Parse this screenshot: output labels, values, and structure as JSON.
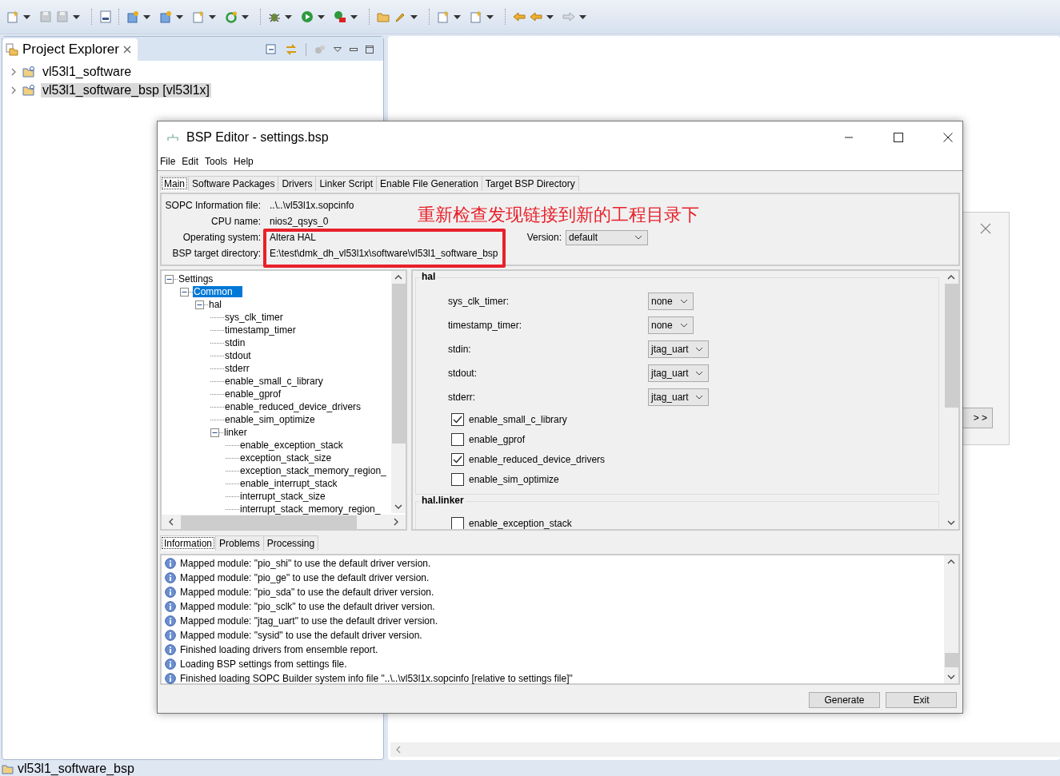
{
  "project_explorer": {
    "title": "Project Explorer",
    "items": [
      {
        "label": "vl53l1_software",
        "expanded": false,
        "selected": false
      },
      {
        "label": "vl53l1_software_bsp [vl53l1x]",
        "expanded": false,
        "selected": true
      }
    ]
  },
  "background_dialog": {
    "button": "> >"
  },
  "dialog": {
    "title": "BSP Editor - settings.bsp",
    "menu": [
      "File",
      "Edit",
      "Tools",
      "Help"
    ],
    "tabs": [
      {
        "label": "Main",
        "selected": true
      },
      {
        "label": "Software Packages",
        "selected": false
      },
      {
        "label": "Drivers",
        "selected": false
      },
      {
        "label": "Linker Script",
        "selected": false
      },
      {
        "label": "Enable File Generation",
        "selected": false
      },
      {
        "label": "Target BSP Directory",
        "selected": false
      }
    ],
    "info": [
      {
        "label": "SOPC Information file:",
        "value": "..\\..\\vl53l1x.sopcinfo"
      },
      {
        "label": "CPU name:",
        "value": "nios2_qsys_0"
      },
      {
        "label": "Operating system:",
        "value": "Altera HAL",
        "version": {
          "label": "Version:",
          "value": "default"
        }
      },
      {
        "label": "BSP target directory:",
        "value": "E:\\test\\dmk_dh_vl53l1x\\software\\vl53l1_software_bsp"
      }
    ],
    "tree": [
      {
        "label": "Settings",
        "expanded": true,
        "selected": false,
        "children": [
          {
            "label": "Common",
            "expanded": true,
            "selected": true,
            "children": [
              {
                "label": "hal",
                "expanded": true,
                "selected": false,
                "children": [
                  {
                    "label": "sys_clk_timer",
                    "selected": false
                  },
                  {
                    "label": "timestamp_timer",
                    "selected": false
                  },
                  {
                    "label": "stdin",
                    "selected": false
                  },
                  {
                    "label": "stdout",
                    "selected": false
                  },
                  {
                    "label": "stderr",
                    "selected": false
                  },
                  {
                    "label": "enable_small_c_library",
                    "selected": false
                  },
                  {
                    "label": "enable_gprof",
                    "selected": false
                  },
                  {
                    "label": "enable_reduced_device_drivers",
                    "selected": false
                  },
                  {
                    "label": "enable_sim_optimize",
                    "selected": false
                  },
                  {
                    "label": "linker",
                    "expanded": true,
                    "selected": false,
                    "children": [
                      {
                        "label": "enable_exception_stack",
                        "selected": false
                      },
                      {
                        "label": "exception_stack_size",
                        "selected": false
                      },
                      {
                        "label": "exception_stack_memory_region_",
                        "selected": false
                      },
                      {
                        "label": "enable_interrupt_stack",
                        "selected": false
                      },
                      {
                        "label": "interrupt_stack_size",
                        "selected": false
                      },
                      {
                        "label": "interrupt_stack_memory_region_",
                        "selected": false
                      }
                    ]
                  }
                ]
              }
            ]
          }
        ]
      }
    ],
    "groups": [
      {
        "title": "hal",
        "fields": [
          {
            "kind": "combo",
            "label": "sys_clk_timer:",
            "value": "none"
          },
          {
            "kind": "combo",
            "label": "timestamp_timer:",
            "value": "none"
          },
          {
            "kind": "combo",
            "label": "stdin:",
            "value": "jtag_uart"
          },
          {
            "kind": "combo",
            "label": "stdout:",
            "value": "jtag_uart"
          },
          {
            "kind": "combo",
            "label": "stderr:",
            "value": "jtag_uart"
          },
          {
            "kind": "checkbox",
            "label": "enable_small_c_library",
            "checked": true
          },
          {
            "kind": "checkbox",
            "label": "enable_gprof",
            "checked": false
          },
          {
            "kind": "checkbox",
            "label": "enable_reduced_device_drivers",
            "checked": true
          },
          {
            "kind": "checkbox",
            "label": "enable_sim_optimize",
            "checked": false
          }
        ]
      },
      {
        "title": "hal.linker",
        "fields": [
          {
            "kind": "checkbox",
            "label": "enable_exception_stack",
            "checked": false
          }
        ]
      }
    ],
    "message_tabs": [
      {
        "label": "Information",
        "selected": true
      },
      {
        "label": "Problems",
        "selected": false
      },
      {
        "label": "Processing",
        "selected": false
      }
    ],
    "messages": [
      "Mapped module: \"pio_shi\" to use the default driver version.",
      "Mapped module: \"pio_ge\" to use the default driver version.",
      "Mapped module: \"pio_sda\" to use the default driver version.",
      "Mapped module: \"pio_sclk\" to use the default driver version.",
      "Mapped module: \"jtag_uart\" to use the default driver version.",
      "Mapped module: \"sysid\" to use the default driver version.",
      "Finished loading drivers from ensemble report.",
      "Loading BSP settings from settings file.",
      "Finished loading SOPC Builder system info file \"..\\..\\vl53l1x.sopcinfo [relative to settings file]\""
    ],
    "buttons": [
      "Generate",
      "Exit"
    ]
  },
  "annotation": {
    "text": "重新检查发现链接到新的工程目录下"
  },
  "status_bar": {
    "text": "vl53l1_software_bsp"
  }
}
